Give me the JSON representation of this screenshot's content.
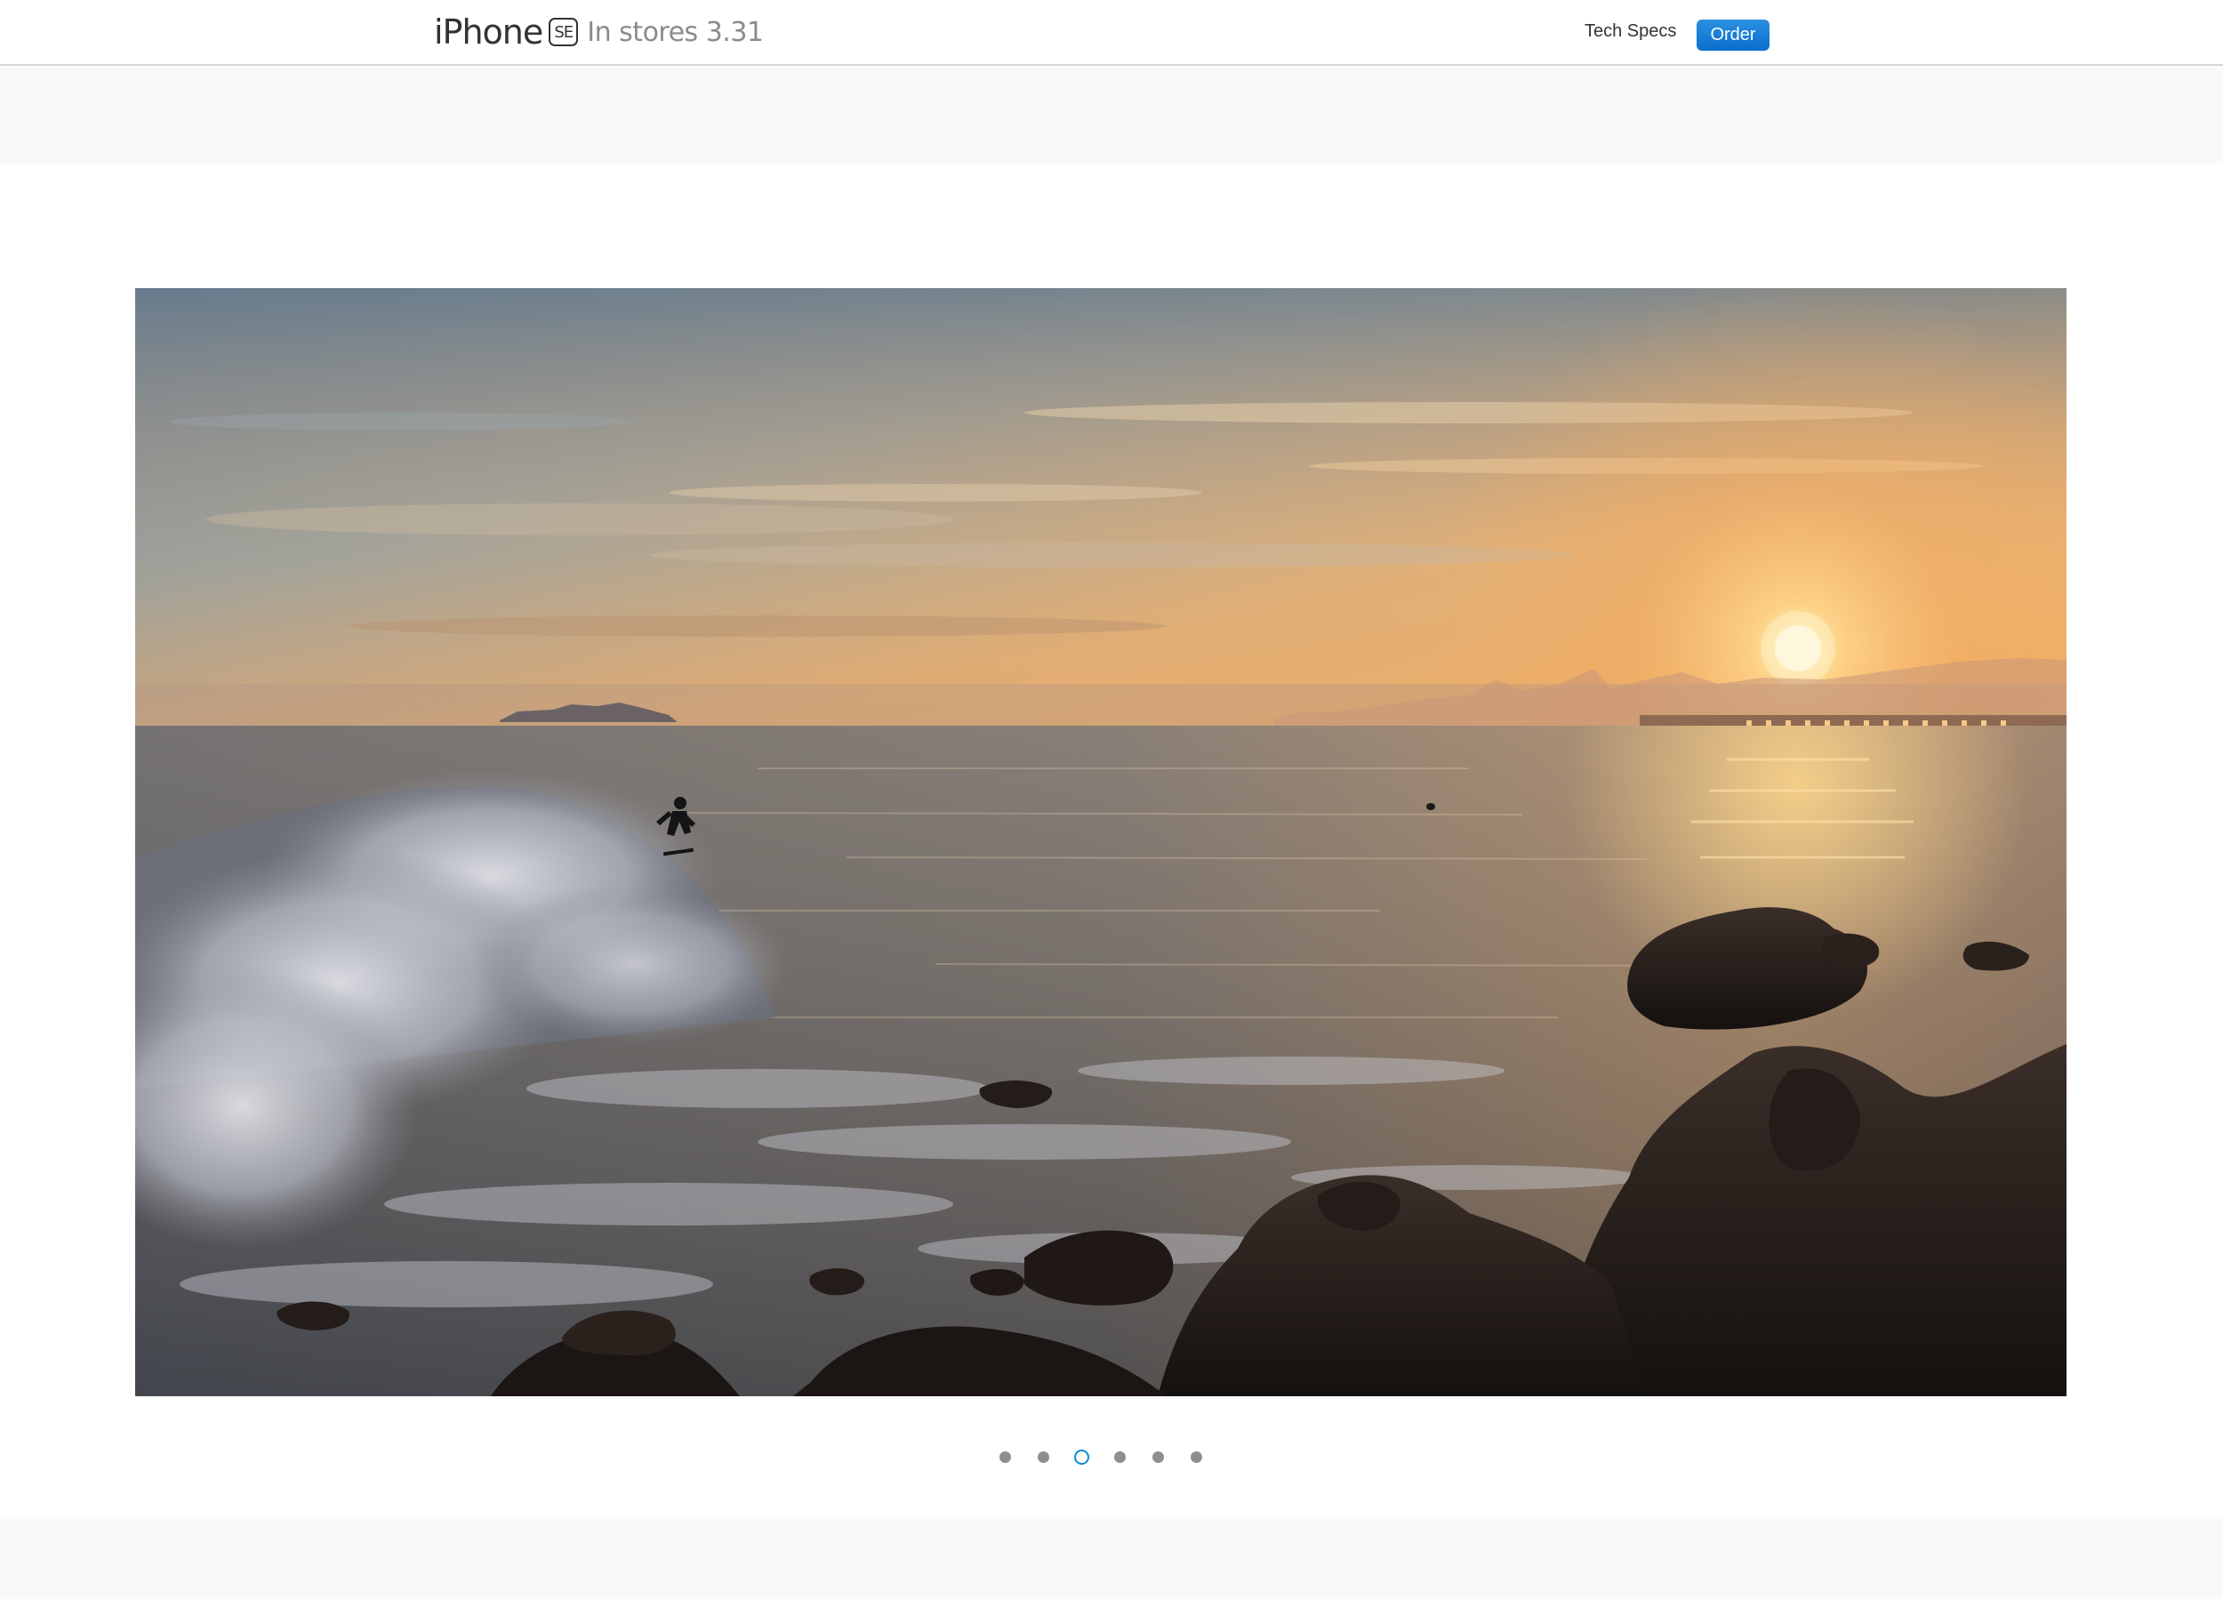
{
  "nav": {
    "brand_name": "iPhone",
    "brand_badge": "SE",
    "tagline": "In stores 3.31",
    "tech_specs_label": "Tech Specs",
    "order_label": "Order"
  },
  "gallery": {
    "pager": {
      "total": 6,
      "active_index": 2
    }
  },
  "colors": {
    "order_button": "#0a6fce",
    "active_dot": "#0a8ecf",
    "inactive_dot": "#8e8e8e"
  }
}
